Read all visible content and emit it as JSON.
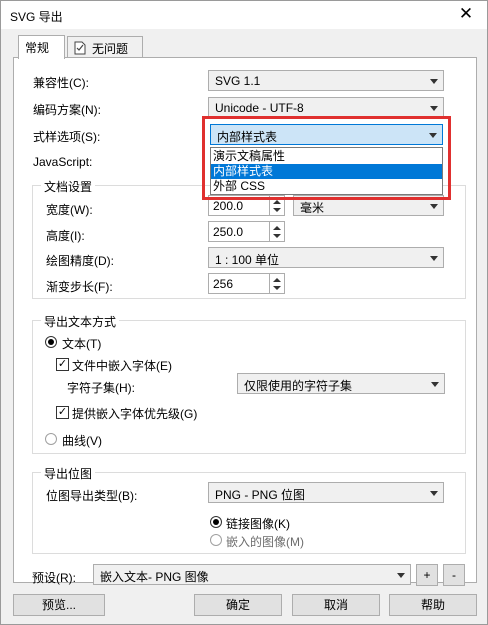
{
  "window": {
    "title": "SVG 导出",
    "close_glyph": "✕"
  },
  "tabs": [
    {
      "label": "常规"
    },
    {
      "label": "无问题"
    }
  ],
  "general": {
    "compat_label": "兼容性(C):",
    "compat_value": "SVG 1.1",
    "encoding_label": "编码方案(N):",
    "encoding_value": "Unicode - UTF-8",
    "style_label": "式样选项(S):",
    "style_value": "内部样式表",
    "javascript_label": "JavaScript:",
    "style_options": [
      "演示文稿属性",
      "内部样式表",
      "外部 CSS"
    ]
  },
  "doc_settings": {
    "title": "文档设置",
    "width_label": "宽度(W):",
    "width_value": "200.0",
    "width_unit": "毫米",
    "height_label": "高度(I):",
    "height_value": "250.0",
    "precision_label": "绘图精度(D):",
    "precision_value": "1 : 100 单位",
    "gradient_label": "渐变步长(F):",
    "gradient_value": "256"
  },
  "text_export": {
    "title": "导出文本方式",
    "text_radio": "文本(T)",
    "embed_fonts": "文件中嵌入字体(E)",
    "subset_label": "字符子集(H):",
    "subset_value": "仅限使用的字符子集",
    "priority": "提供嵌入字体优先级(G)",
    "curves_radio": "曲线(V)"
  },
  "bitmap_export": {
    "title": "导出位图",
    "type_label": "位图导出类型(B):",
    "type_value": "PNG - PNG 位图",
    "link_radio": "链接图像(K)",
    "embed_radio": "嵌入的图像(M)"
  },
  "preset": {
    "label": "预设(R):",
    "value": "嵌入文本- PNG 图像",
    "add": "+",
    "remove": "-"
  },
  "footer": {
    "preview": "预览...",
    "ok": "确定",
    "cancel": "取消",
    "help": "帮助"
  },
  "colors": {
    "accent": "#0078d7",
    "highlight_box": "#e0302f"
  }
}
